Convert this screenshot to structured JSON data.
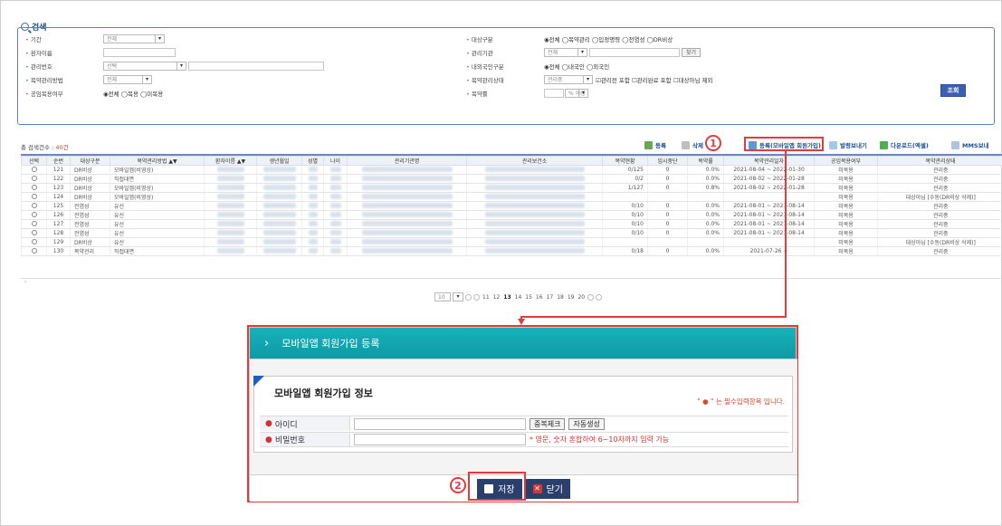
{
  "search": {
    "title": "검색",
    "fields_left": [
      {
        "label": "기간",
        "value": "전체"
      },
      {
        "label": "환자이름"
      },
      {
        "label": "관리번호",
        "value": "선택"
      },
      {
        "label": "복약관리방법",
        "value": "전체"
      },
      {
        "label": "공임복용여부",
        "radios": "◉전체 ◯복용 ◯미복용"
      }
    ],
    "fields_right": [
      {
        "label": "대상구분",
        "radios": "◉전체 ◯복약관리 ◯입정명령 ◯전염성 ◯DR비상"
      },
      {
        "label": "관리기관",
        "value": "전체",
        "btn": "찾기"
      },
      {
        "label": "내외국인구분",
        "radios": "◉전체 ◯내국인 ◯외국인"
      },
      {
        "label": "복약관리상태",
        "value": "관리중",
        "radios": "☑관리전 포함  ☐관리완료 포함  ☐대상아님 제외"
      },
      {
        "label": "복약률",
        "value": "% 이상"
      }
    ],
    "search_button": "조회"
  },
  "toolbar": {
    "total_label": "총 검색건수 :",
    "total_count": "40건",
    "register": "등록",
    "delete": "삭제",
    "register_mobile": "등록(모바일앱 회원가입)",
    "send": "발령보내기",
    "download": "다운로드(엑셀)",
    "mms": "MMS보내"
  },
  "table": {
    "headers": [
      "선택",
      "순번",
      "대상구분",
      "복약관리방법 ▲▼",
      "환자이름 ▲▼",
      "생년월일",
      "성별",
      "나이",
      "관리기관명",
      "관리보건소",
      "복약현황",
      "입시중단",
      "복약률",
      "복약관리일자",
      "공임복용여부",
      "복약관리상태"
    ],
    "rows": [
      [
        "121",
        "DR비상",
        "모바일앱(비영상)",
        "0/125",
        "0",
        "0.0%",
        "2021-08-04 ~ 2022-01-30",
        "미복용",
        "관리중"
      ],
      [
        "122",
        "DR비상",
        "직접대면",
        "0/2",
        "0",
        "0.0%",
        "2021-08-02 ~ 2022-01-28",
        "미복용",
        "관리중"
      ],
      [
        "123",
        "DR비상",
        "모바일앱(비영상)",
        "1/127",
        "0",
        "0.8%",
        "2021-08-02 ~ 2022-01-28",
        "미복용",
        "관리중"
      ],
      [
        "124",
        "DR비상",
        "모바일앱(비영상)",
        "",
        "",
        "",
        "",
        "미복용",
        "대상아님 [수동(DR비상 삭제)]"
      ],
      [
        "125",
        "전염성",
        "유선",
        "0/10",
        "0",
        "0.0%",
        "2021-08-01 ~ 2021-08-14",
        "미복용",
        "관리중"
      ],
      [
        "126",
        "전염성",
        "유선",
        "0/10",
        "0",
        "0.0%",
        "2021-08-01 ~ 2021-08-14",
        "미복용",
        "관리중"
      ],
      [
        "127",
        "전염성",
        "유선",
        "0/10",
        "0",
        "0.0%",
        "2021-08-01 ~ 2021-08-14",
        "미복용",
        "관리중"
      ],
      [
        "128",
        "전염성",
        "유선",
        "0/10",
        "0",
        "0.0%",
        "2021-08-01 ~ 2021-08-14",
        "미복용",
        "관리중"
      ],
      [
        "129",
        "DR비상",
        "유선",
        "",
        "",
        "",
        "",
        "미복용",
        "대상아님 [수동(DR비상 삭제)]"
      ],
      [
        "130",
        "복약관리",
        "직접대면",
        "0/18",
        "0",
        "0.0%",
        "2021-07-26 ~",
        "미복용",
        "관리중"
      ]
    ]
  },
  "paging": {
    "page_size": "10",
    "pages": [
      "11",
      "12",
      "13",
      "14",
      "15",
      "16",
      "17",
      "18",
      "19",
      "20"
    ],
    "current": "13"
  },
  "modal": {
    "title": "모바일앱 회원가입 등록",
    "section_title": "모바일앱 회원가입 정보",
    "required_note": "\" ● \" 는 필수입력항목 입니다.",
    "id_label": "아이디",
    "dup_check": "중복체크",
    "auto_gen": "자동생성",
    "pw_label": "비밀번호",
    "pw_hint": "* 영문, 숫자 혼합하여 6~10자까지 입력 가능",
    "save": "저장",
    "close": "닫기"
  },
  "annotations": {
    "step1": "1",
    "step2": "2"
  },
  "colors": {
    "accent_teal": "#13a9b2",
    "annotation_red": "#e23b3b",
    "navy_button": "#2b3f6d"
  }
}
